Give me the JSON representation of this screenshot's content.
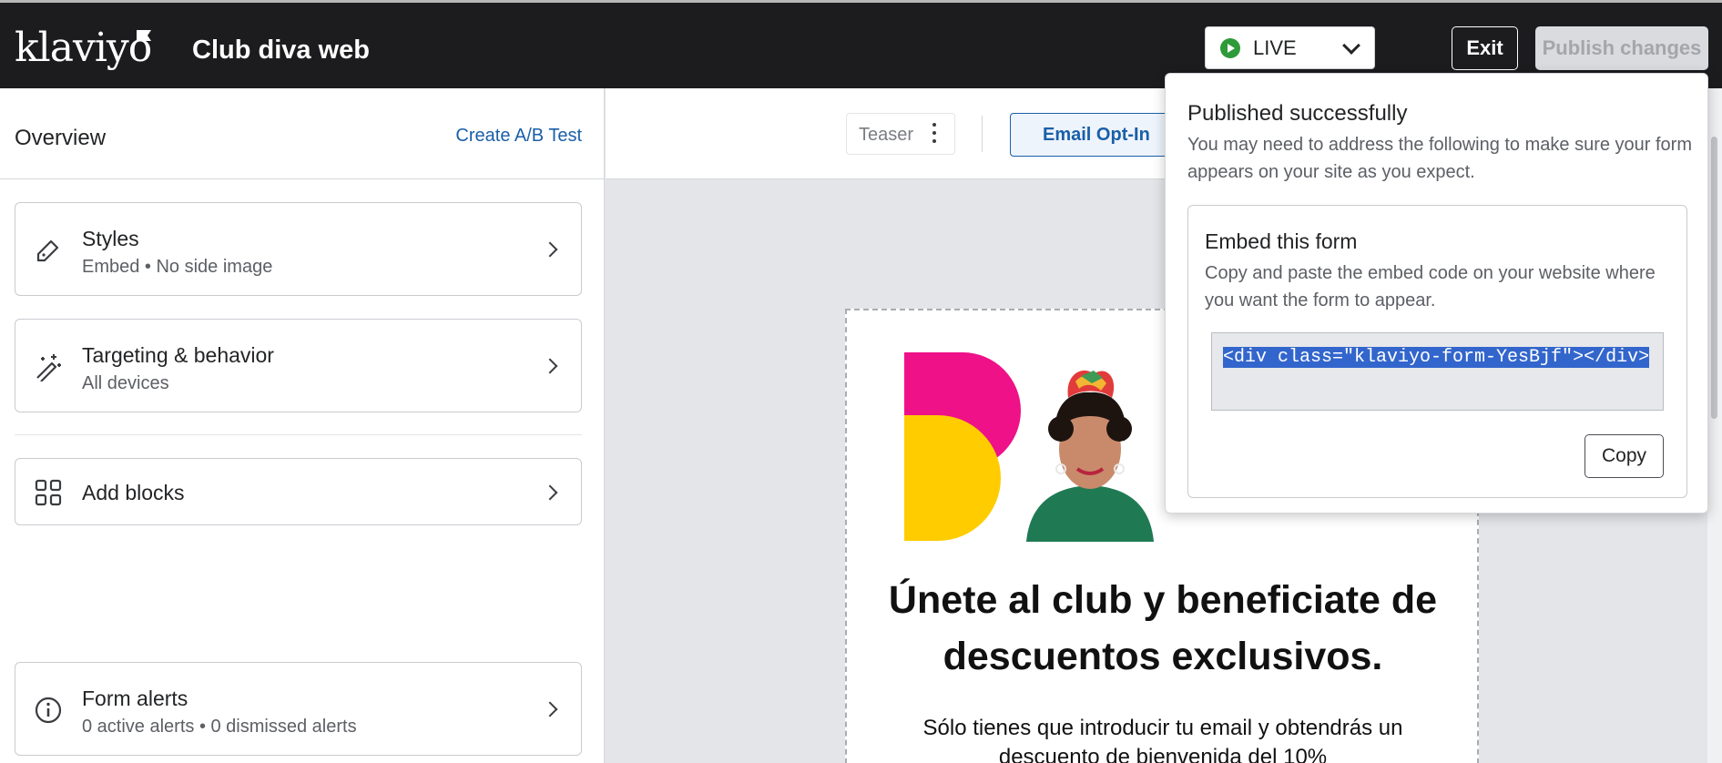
{
  "header": {
    "logo": "klaviyo",
    "title": "Club diva web",
    "status": "LIVE",
    "exit_label": "Exit",
    "publish_label": "Publish changes"
  },
  "sidebar": {
    "title": "Overview",
    "ab_test_link": "Create A/B Test",
    "cards": [
      {
        "title": "Styles",
        "subtitle": "Embed • No side image",
        "icon": "pencil-icon"
      },
      {
        "title": "Targeting & behavior",
        "subtitle": "All devices",
        "icon": "magic-wand-icon"
      },
      {
        "title": "Add blocks",
        "icon": "grid-icon"
      },
      {
        "title": "Form alerts",
        "subtitle": "0 active alerts • 0 dismissed alerts",
        "icon": "info-icon"
      }
    ]
  },
  "tabs": {
    "teaser": "Teaser",
    "optin": "Email Opt-In"
  },
  "preview": {
    "heading": "Únete al club y beneficiate de descuentos exclusivos.",
    "subtext": "Sólo tienes que introducir tu email y obtendrás un descuento de bienvenida del 10%"
  },
  "popover": {
    "title": "Published successfully",
    "body": "You may need to address the following to make sure your form appears on your site as you expect.",
    "embed_title": "Embed this form",
    "embed_body": "Copy and paste the embed code on your website where you want the form to appear.",
    "code": "<div class=\"klaviyo-form-YesBjf\"></div>",
    "copy_label": "Copy"
  },
  "colors": {
    "topbar": "#1c1c1e",
    "link": "#1a5fa8",
    "live_green": "#2e9a3a",
    "brand_pink": "#ee1188",
    "brand_yellow": "#ffcc00",
    "selection": "#3366cc"
  }
}
